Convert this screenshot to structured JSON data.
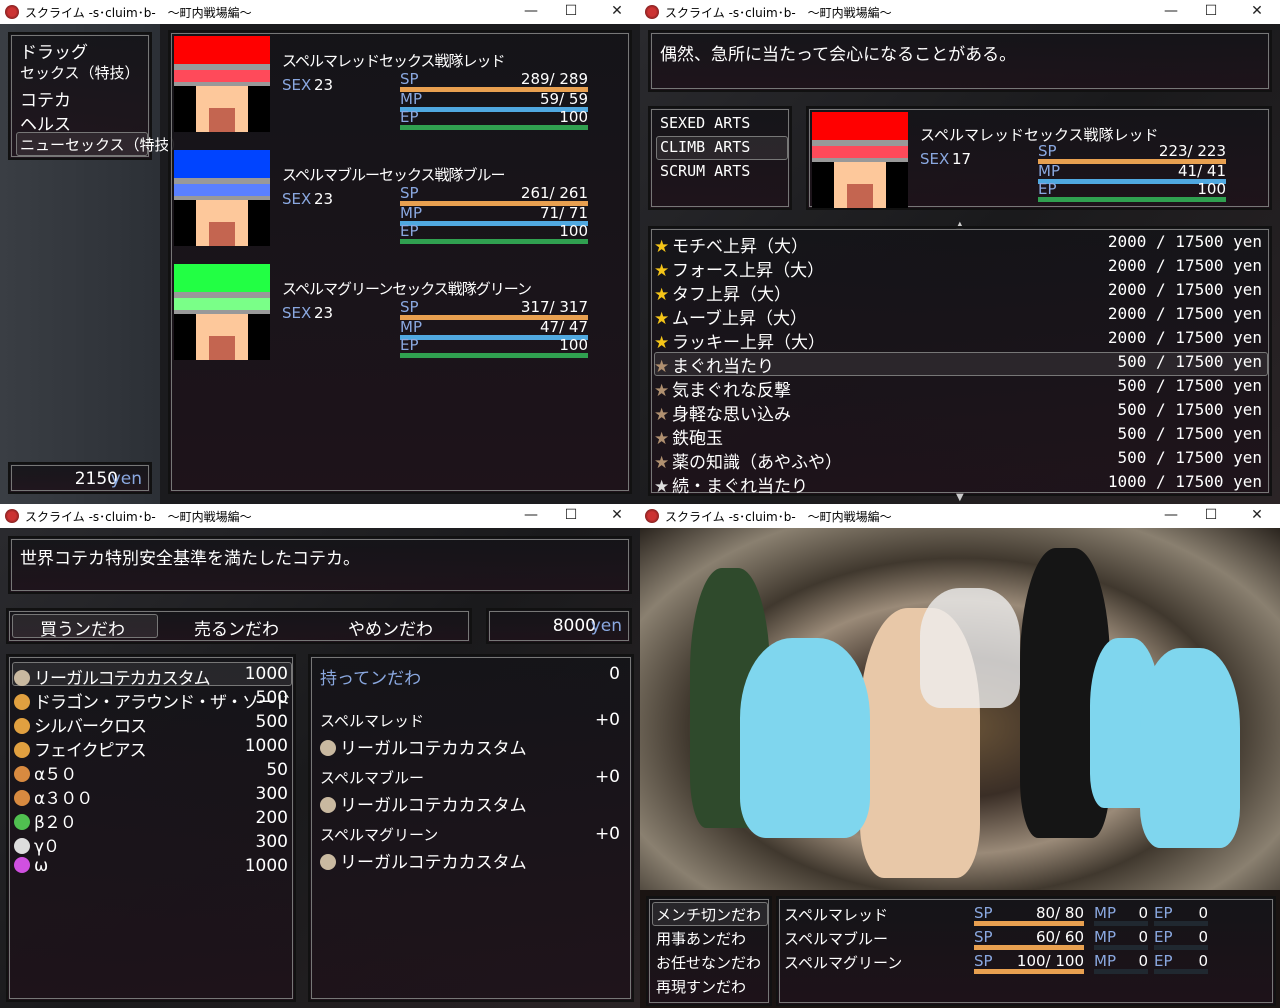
{
  "window": {
    "title": "スクライム -s･cluim･b-　～町内戦場編～",
    "minimize": "—",
    "maximize": "☐",
    "close": "✕",
    "icon": "game-app-icon"
  },
  "q1": {
    "menu": [
      "ドラッグ",
      "セックス（特技）",
      "コテカ",
      "ヘルス",
      "ニューセックス（特技）"
    ],
    "gold": {
      "value": "2150",
      "unit": "yen"
    },
    "actors": [
      {
        "name": "スペルマレッドセックス戦隊レッド",
        "level_label": "SEX",
        "level": "23",
        "sp_label": "SP",
        "sp": "289/ 289",
        "sp_rate": 1,
        "mp_label": "MP",
        "mp": "59/  59",
        "mp_rate": 1,
        "ep_label": "EP",
        "ep": "100",
        "ep_rate": 1,
        "color1": "#ff0000",
        "color2": "#ff4a5a"
      },
      {
        "name": "スペルマブルーセックス戦隊ブルー",
        "level_label": "SEX",
        "level": "23",
        "sp_label": "SP",
        "sp": "261/ 261",
        "sp_rate": 1,
        "mp_label": "MP",
        "mp": "71/  71",
        "mp_rate": 1,
        "ep_label": "EP",
        "ep": "100",
        "ep_rate": 1,
        "color1": "#0044ff",
        "color2": "#5a80ff"
      },
      {
        "name": "スペルマグリーンセックス戦隊グリーン",
        "level_label": "SEX",
        "level": "23",
        "sp_label": "SP",
        "sp": "317/ 317",
        "sp_rate": 1,
        "mp_label": "MP",
        "mp": "47/  47",
        "mp_rate": 1,
        "ep_label": "EP",
        "ep": "100",
        "ep_rate": 1,
        "color1": "#22ff44",
        "color2": "#7aff88"
      }
    ]
  },
  "q2": {
    "help": "偶然、急所に当たって会心になることがある。",
    "categories": [
      "SEXED ARTS",
      "CLIMB ARTS",
      "SCRUM ARTS"
    ],
    "selected_category": "CLIMB ARTS",
    "actor": {
      "name": "スペルマレッドセックス戦隊レッド",
      "level_label": "SEX",
      "level": "17",
      "sp_label": "SP",
      "sp": "223/ 223",
      "mp_label": "MP",
      "mp": "41/  41",
      "ep_label": "EP",
      "ep": "100"
    },
    "skills": [
      {
        "name": "モチベ上昇（大）",
        "cost": "2000 / 17500 yen",
        "star": "gold"
      },
      {
        "name": "フォース上昇（大）",
        "cost": "2000 / 17500 yen",
        "star": "gold"
      },
      {
        "name": "タフ上昇（大）",
        "cost": "2000 / 17500 yen",
        "star": "gold"
      },
      {
        "name": "ムーブ上昇（大）",
        "cost": "2000 / 17500 yen",
        "star": "gold"
      },
      {
        "name": "ラッキー上昇（大）",
        "cost": "2000 / 17500 yen",
        "star": "gold"
      },
      {
        "name": "まぐれ当たり",
        "cost": "500 / 17500 yen",
        "star": "bronze"
      },
      {
        "name": "気まぐれな反撃",
        "cost": "500 / 17500 yen",
        "star": "bronze"
      },
      {
        "name": "身軽な思い込み",
        "cost": "500 / 17500 yen",
        "star": "bronze"
      },
      {
        "name": "鉄砲玉",
        "cost": "500 / 17500 yen",
        "star": "bronze"
      },
      {
        "name": "薬の知識（あやふや）",
        "cost": "500 / 17500 yen",
        "star": "bronze"
      },
      {
        "name": "続・まぐれ当たり",
        "cost": "1000 / 17500 yen",
        "star": "silver"
      }
    ],
    "selected_skill": "まぐれ当たり"
  },
  "q3": {
    "help": "世界コテカ特別安全基準を満たしたコテカ。",
    "commands": [
      "買うンだわ",
      "売るンだわ",
      "やめンだわ"
    ],
    "gold": {
      "value": "8000",
      "unit": "yen"
    },
    "items": [
      {
        "name": "リーガルコテカカスタム",
        "price": "1000",
        "icon": "horn-icon",
        "color": "#c9b9a0"
      },
      {
        "name": "ドラゴン・アラウンド・ザ・ソード",
        "price": "500",
        "icon": "ring-icon",
        "color": "#e0a040"
      },
      {
        "name": "シルバークロス",
        "price": "500",
        "icon": "ring-icon",
        "color": "#e0a040"
      },
      {
        "name": "フェイクピアス",
        "price": "1000",
        "icon": "ring-icon",
        "color": "#e0a040"
      },
      {
        "name": "α５０",
        "price": "50",
        "icon": "bread-icon",
        "color": "#d88a40"
      },
      {
        "name": "α３００",
        "price": "300",
        "icon": "bread-icon",
        "color": "#d88a40"
      },
      {
        "name": "β２０",
        "price": "200",
        "icon": "bottle-icon",
        "color": "#50c050"
      },
      {
        "name": "γ０",
        "price": "300",
        "icon": "powder-icon",
        "color": "#ddd"
      },
      {
        "name": "ω",
        "price": "1000",
        "icon": "potion-icon",
        "color": "#d050e0"
      }
    ],
    "possession_label": "持ってンだわ",
    "possession": "0",
    "equips": [
      {
        "actor": "スペルマレッド",
        "change": "+0",
        "item": "リーガルコテカカスタム"
      },
      {
        "actor": "スペルマブルー",
        "change": "+0",
        "item": "リーガルコテカカスタム"
      },
      {
        "actor": "スペルマグリーン",
        "change": "+0",
        "item": "リーガルコテカカスタム"
      }
    ]
  },
  "q4": {
    "party_commands": [
      "メンチ切ンだわ",
      "用事あンだわ",
      "お任せなンだわ",
      "再現すンだわ"
    ],
    "actors": [
      {
        "name": "スペルマレッド",
        "sp_label": "SP",
        "sp": "80/  80",
        "mp_label": "MP",
        "mp": "0",
        "ep_label": "EP",
        "ep": "0"
      },
      {
        "name": "スペルマブルー",
        "sp_label": "SP",
        "sp": "60/  60",
        "mp_label": "MP",
        "mp": "0",
        "ep_label": "EP",
        "ep": "0"
      },
      {
        "name": "スペルマグリーン",
        "sp_label": "SP",
        "sp": "100/ 100",
        "mp_label": "MP",
        "mp": "0",
        "ep_label": "EP",
        "ep": "0"
      }
    ]
  },
  "colors": {
    "sp": "#e8a050",
    "mp": "#50a8e0",
    "ep": "#30a050",
    "system_blue": "#8aa8e0"
  }
}
